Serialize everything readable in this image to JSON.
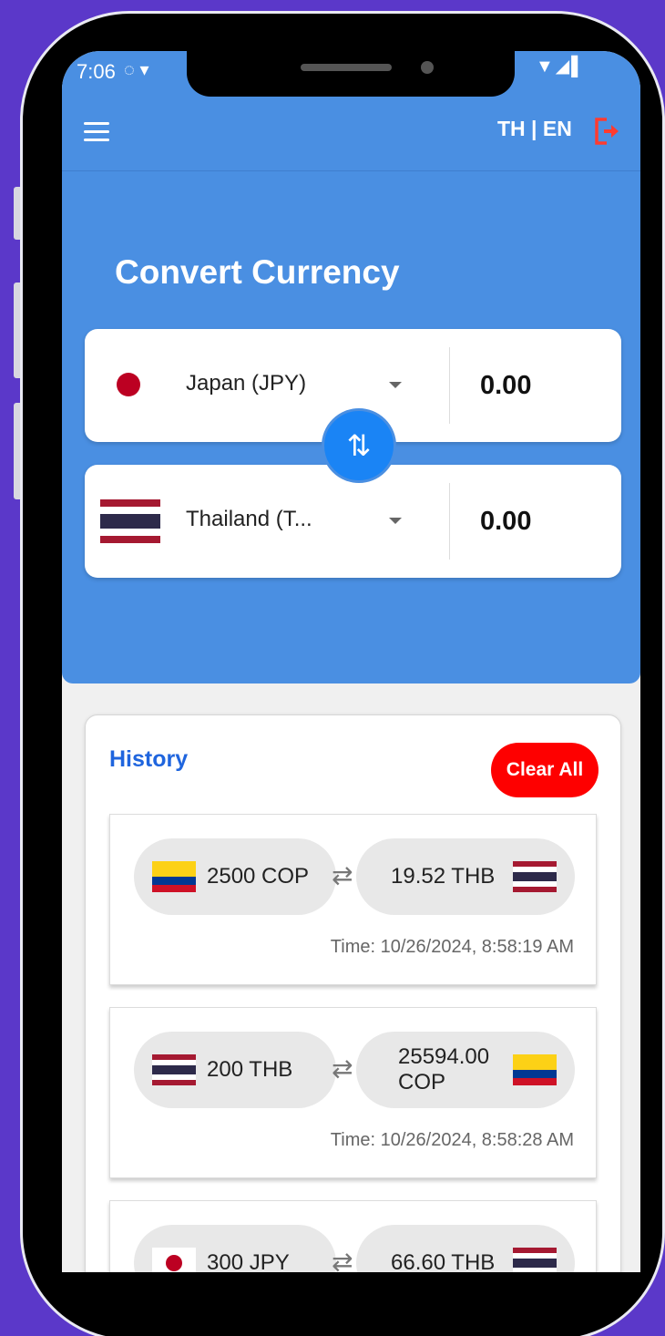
{
  "status": {
    "time": "7:06",
    "left_icons": "◌ ▾",
    "right_icons": "▼◢▌"
  },
  "header": {
    "lang_label": "TH | EN",
    "menu_icon": "hamburger-menu-icon",
    "logout_icon": "logout-icon"
  },
  "converter": {
    "title": "Convert Currency",
    "from": {
      "country": "Japan (JPY)",
      "amount": "0.00"
    },
    "to": {
      "country": "Thailand (T...",
      "amount": "0.00"
    },
    "swap_symbol": "⇅"
  },
  "history": {
    "title": "History",
    "clear_label": "Clear All",
    "swap_symbol": "⇄",
    "entries": [
      {
        "from": "2500 COP",
        "to": "19.52 THB",
        "time": "Time: 10/26/2024, 8:58:19 AM"
      },
      {
        "from": "200 THB",
        "to": "25594.00 COP",
        "time": "Time: 10/26/2024, 8:58:28 AM"
      },
      {
        "from": "300 JPY",
        "to": "66.60 THB",
        "time": ""
      }
    ]
  },
  "colors": {
    "background": "#5b38c9",
    "header_blue": "#4a8fe2",
    "swap_blue": "#1a84f5",
    "history_title": "#1f65de",
    "clear_red": "#fe0000"
  }
}
